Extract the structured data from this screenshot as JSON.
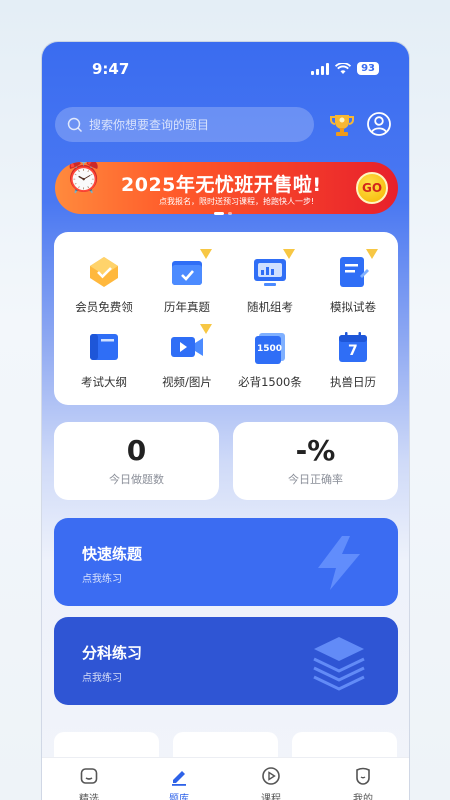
{
  "status_bar": {
    "time": "9:47",
    "battery": "93"
  },
  "search": {
    "placeholder": "搜索你想要查询的题目"
  },
  "banner": {
    "title": "2025年无忧班开售啦!",
    "subtitle": "点我报名，限时送预习课程，抢跑快人一步!",
    "go": "GO"
  },
  "grid": [
    {
      "label": "会员免费领",
      "icon": "vip-gift-icon",
      "vip": false
    },
    {
      "label": "历年真题",
      "icon": "folder-check-icon",
      "vip": true
    },
    {
      "label": "随机组考",
      "icon": "monitor-chart-icon",
      "vip": true
    },
    {
      "label": "模拟试卷",
      "icon": "exam-paper-icon",
      "vip": true
    },
    {
      "label": "考试大纲",
      "icon": "book-icon",
      "vip": false
    },
    {
      "label": "视频/图片",
      "icon": "video-camera-icon",
      "vip": true
    },
    {
      "label": "必背1500条",
      "icon": "flashcards-icon",
      "vip": false,
      "badge": "1500"
    },
    {
      "label": "执兽日历",
      "icon": "calendar-icon",
      "vip": false,
      "badge": "7"
    }
  ],
  "stats": [
    {
      "value": "0",
      "caption": "今日做题数"
    },
    {
      "value": "-%",
      "caption": "今日正确率"
    }
  ],
  "actions": [
    {
      "title": "快速练题",
      "subtitle": "点我练习",
      "icon": "lightning-icon"
    },
    {
      "title": "分科练习",
      "subtitle": "点我练习",
      "icon": "layers-icon"
    }
  ],
  "tabbar": [
    {
      "label": "精选",
      "icon": "home-icon",
      "active": false
    },
    {
      "label": "题库",
      "icon": "pen-icon",
      "active": true
    },
    {
      "label": "课程",
      "icon": "play-circle-icon",
      "active": false
    },
    {
      "label": "我的",
      "icon": "profile-icon",
      "active": false
    }
  ],
  "colors": {
    "primary": "#3a6cf0",
    "action_blue": "#3b6cf2",
    "action_dark_blue": "#2f55d4",
    "banner_red": "#e8202b",
    "active_tab": "#2e62e8"
  }
}
